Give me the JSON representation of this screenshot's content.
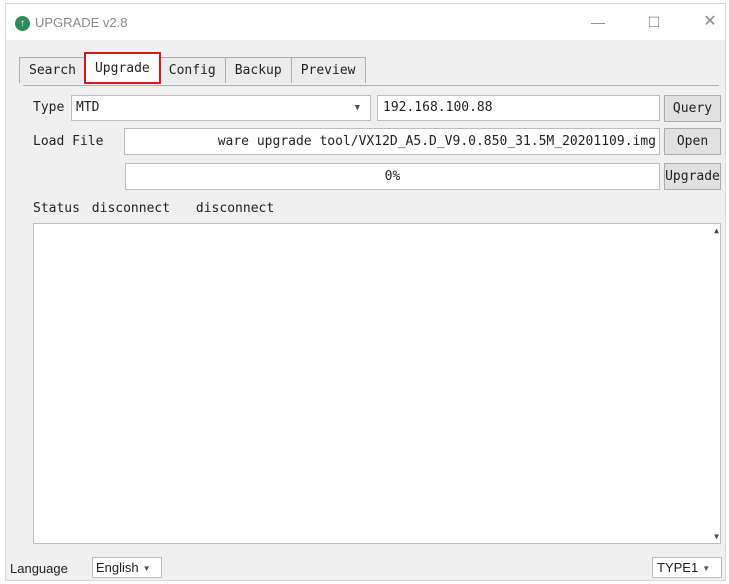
{
  "window": {
    "title": "UPGRADE v2.8",
    "icon": "upgrade-arrow-icon",
    "controls": {
      "minimize": "—",
      "maximize": "☐",
      "close": "✕"
    }
  },
  "tabs": [
    {
      "label": "Search",
      "active": false
    },
    {
      "label": "Upgrade",
      "active": true
    },
    {
      "label": "Config",
      "active": false
    },
    {
      "label": "Backup",
      "active": false
    },
    {
      "label": "Preview",
      "active": false
    }
  ],
  "upgrade": {
    "type_label": "Type",
    "type_value": "MTD",
    "ip_value": "192.168.100.88",
    "query_label": "Query",
    "loadfile_label": "Load File",
    "file_path": "ware upgrade tool/VX12D_A5.D_V9.0.850_31.5M_20201109.img",
    "open_label": "Open",
    "progress_percent": 0,
    "progress_text": "0%",
    "upgrade_label": "Upgrade",
    "status_label": "Status",
    "status_value_1": "disconnect",
    "status_value_2": "disconnect",
    "log_text": ""
  },
  "footer": {
    "language_label": "Language",
    "language_value": "English",
    "type_combo_value": "TYPE1"
  },
  "colors": {
    "highlight_outline": "#d21c1c",
    "app_icon": "#2e8b57",
    "progress_fill": "#06b025"
  }
}
